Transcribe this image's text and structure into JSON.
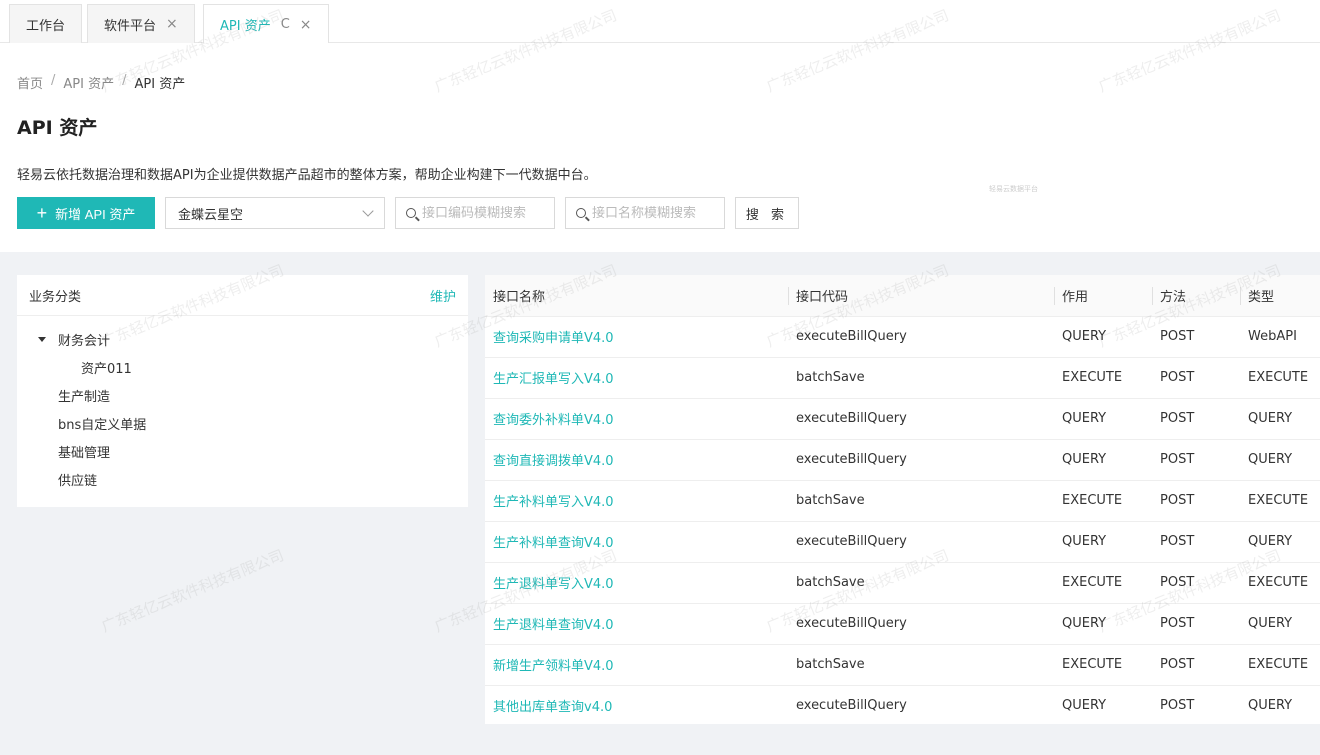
{
  "tabs": [
    {
      "label": "工作台"
    },
    {
      "label": "软件平台",
      "close": "×"
    },
    {
      "label": "API 资产",
      "refresh": "C",
      "close": "×"
    }
  ],
  "breadcrumb": {
    "items": [
      "首页",
      "API 资产",
      "API 资产"
    ],
    "sep": "/"
  },
  "page": {
    "title": "API 资产",
    "description": "轻易云依托数据治理和数据API为企业提供数据产品超市的整体方案，帮助企业构建下一代数据中台。",
    "tiny_note": "轻易云数据平台"
  },
  "toolbar": {
    "add_label": "新增 API 资产",
    "select_value": "金蝶云星空",
    "code_placeholder": "接口编码模糊搜索",
    "name_placeholder": "接口名称模糊搜索",
    "search_label": "搜 索"
  },
  "left_panel": {
    "title": "业务分类",
    "action": "维护",
    "tree": [
      {
        "label": "财务会计",
        "expanded": true
      },
      {
        "label": "资产011"
      },
      {
        "label": "生产制造"
      },
      {
        "label": "bns自定义单据"
      },
      {
        "label": "基础管理"
      },
      {
        "label": "供应链"
      }
    ]
  },
  "table": {
    "columns": [
      "接口名称",
      "接口代码",
      "作用",
      "方法",
      "类型"
    ],
    "rows": [
      [
        "查询采购申请单V4.0",
        "executeBillQuery",
        "QUERY",
        "POST",
        "WebAPI"
      ],
      [
        "生产汇报单写入V4.0",
        "batchSave",
        "EXECUTE",
        "POST",
        "EXECUTE"
      ],
      [
        "查询委外补料单V4.0",
        "executeBillQuery",
        "QUERY",
        "POST",
        "QUERY"
      ],
      [
        "查询直接调拨单V4.0",
        "executeBillQuery",
        "QUERY",
        "POST",
        "QUERY"
      ],
      [
        "生产补料单写入V4.0",
        "batchSave",
        "EXECUTE",
        "POST",
        "EXECUTE"
      ],
      [
        "生产补料单查询V4.0",
        "executeBillQuery",
        "QUERY",
        "POST",
        "QUERY"
      ],
      [
        "生产退料单写入V4.0",
        "batchSave",
        "EXECUTE",
        "POST",
        "EXECUTE"
      ],
      [
        "生产退料单查询V4.0",
        "executeBillQuery",
        "QUERY",
        "POST",
        "QUERY"
      ],
      [
        "新增生产领料单V4.0",
        "batchSave",
        "EXECUTE",
        "POST",
        "EXECUTE"
      ],
      [
        "其他出库单查询v4.0",
        "executeBillQuery",
        "QUERY",
        "POST",
        "QUERY"
      ]
    ]
  },
  "watermark": "广东轻亿云软件科技有限公司",
  "colors": {
    "accent": "#1fb8b6",
    "background": "#f0f2f5"
  }
}
